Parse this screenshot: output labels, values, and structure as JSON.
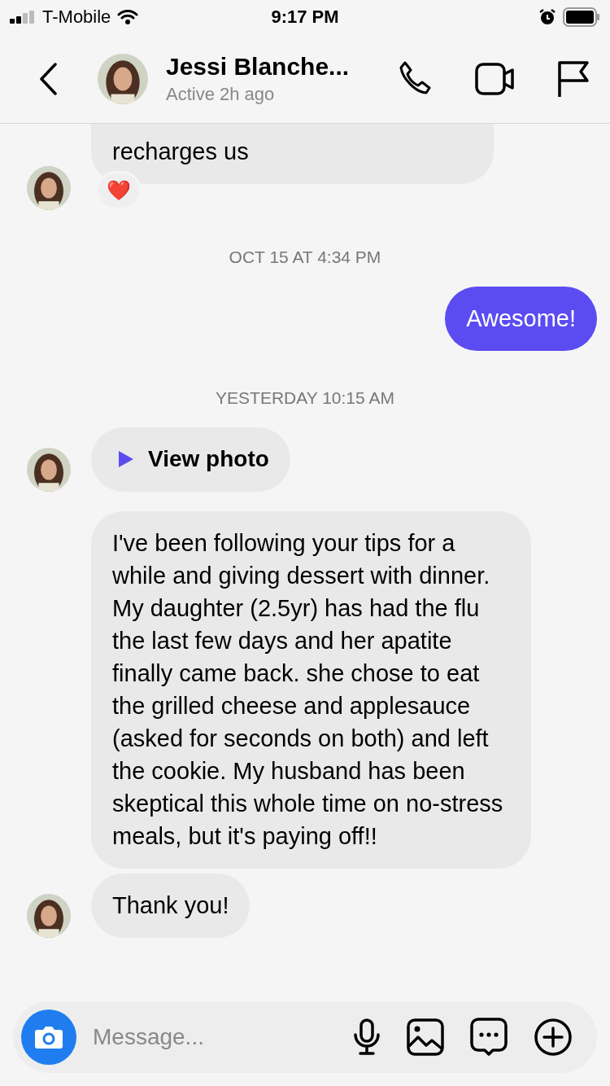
{
  "status_bar": {
    "carrier": "T-Mobile",
    "time": "9:17 PM"
  },
  "header": {
    "name": "Jessi Blanche...",
    "presence": "Active 2h ago"
  },
  "messages": [
    {
      "kind": "received",
      "text": "recharges us",
      "avatar": true,
      "cut_top": true,
      "reaction": "❤️"
    },
    {
      "kind": "time",
      "text": "OCT 15 AT 4:34 PM"
    },
    {
      "kind": "sent",
      "text": "Awesome!"
    },
    {
      "kind": "time",
      "text": "YESTERDAY 10:15 AM"
    },
    {
      "text": "View photo",
      "avatar": true
    },
    {
      "kind": "received",
      "text": "I've been following your tips for a while and giving dessert with dinner. My daughter (2.5yr)  has had the flu the last few days and her apatite finally came back. she chose to eat the grilled cheese and applesauce (asked for seconds on both) and left the cookie. My husband has been skeptical this whole time on no-stress meals, but it's paying off!!",
      "avatar": false
    },
    {
      "kind": "received",
      "text": "Thank you!",
      "avatar": true
    }
  ],
  "composer": {
    "placeholder": "Message..."
  }
}
